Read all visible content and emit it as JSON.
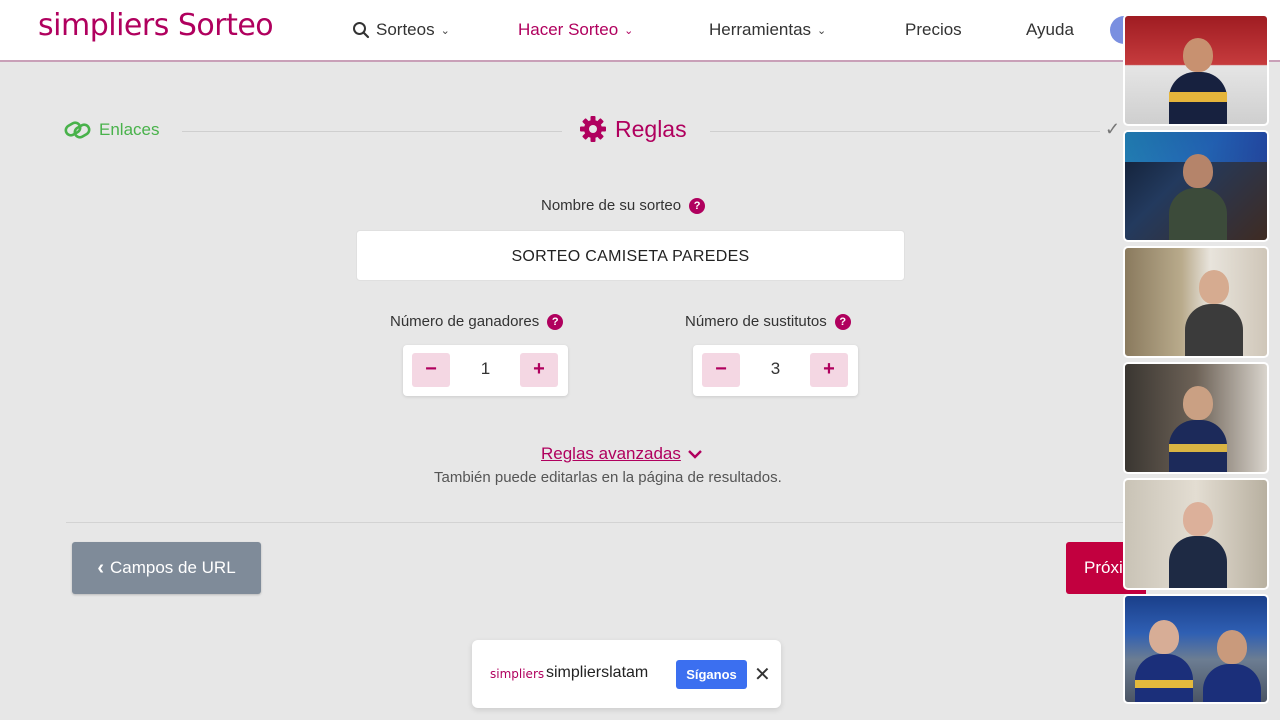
{
  "header": {
    "logo": "simpliers Sorteo",
    "nav": [
      {
        "label": "Sorteos",
        "icon": "search-icon",
        "has_dropdown": true
      },
      {
        "label": "Hacer Sorteo",
        "has_dropdown": true,
        "active": true
      },
      {
        "label": "Herramientas",
        "has_dropdown": true
      },
      {
        "label": "Precios"
      },
      {
        "label": "Ayuda"
      }
    ]
  },
  "steps": {
    "enlaces": "Enlaces",
    "reglas": "Reglas"
  },
  "form": {
    "name_label": "Nombre de su sorteo",
    "name_value": "SORTEO CAMISETA PAREDES",
    "winners_label": "Número de ganadores",
    "winners_value": "1",
    "substitutes_label": "Número de sustitutos",
    "substitutes_value": "3",
    "help_glyph": "?",
    "minus": "−",
    "plus": "+",
    "advanced_link": "Reglas avanzadas",
    "advanced_note": "También puede editarlas en la página de resultados."
  },
  "buttons": {
    "back": "Campos de URL",
    "next": "Próxi"
  },
  "follow_bar": {
    "logo_text": "simpliers",
    "account": "simplierslatam",
    "follow": "Síganos",
    "close": "✕"
  },
  "colors": {
    "brand": "#b0005e",
    "success": "#49b24b",
    "next_button": "#c2003f",
    "back_button": "#7f8b99",
    "follow_button": "#3b6ff0"
  },
  "video_participants": [
    {
      "icon": "participant-video-1"
    },
    {
      "icon": "participant-video-2"
    },
    {
      "icon": "participant-video-3"
    },
    {
      "icon": "participant-video-4"
    },
    {
      "icon": "participant-video-5"
    },
    {
      "icon": "participant-video-6"
    }
  ]
}
